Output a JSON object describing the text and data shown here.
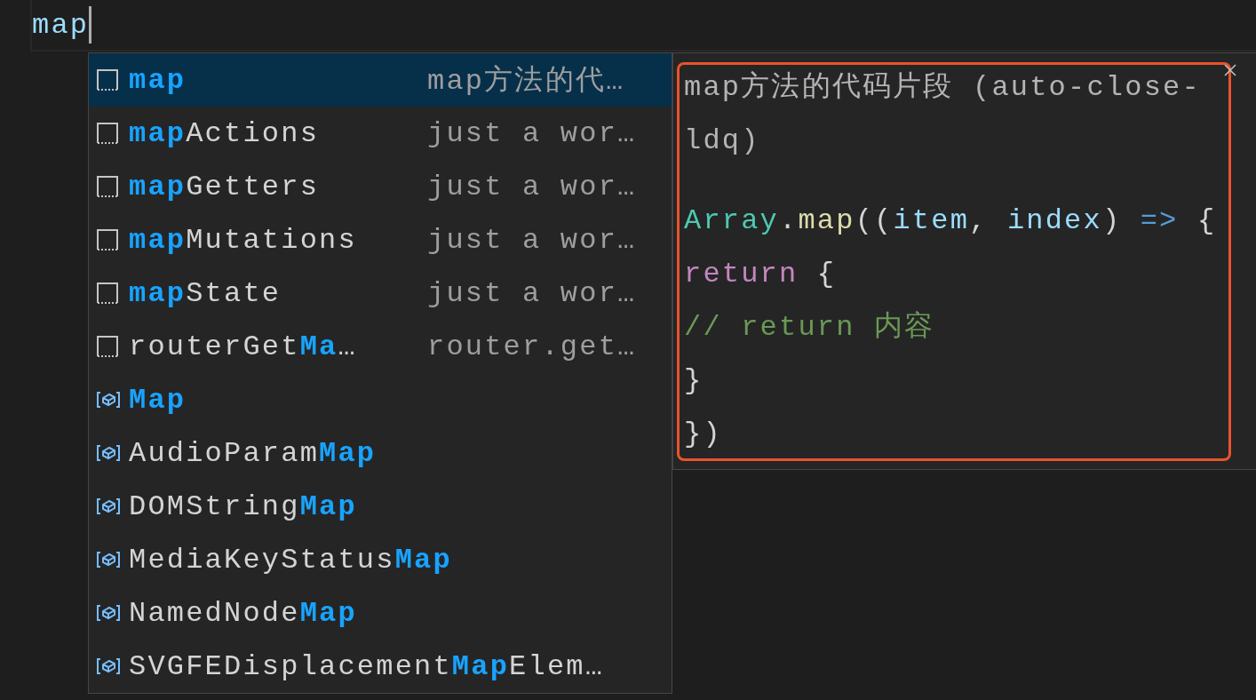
{
  "editor": {
    "text": "map"
  },
  "suggestions": [
    {
      "kind": "snippet",
      "label": "**map**",
      "detail": "map方法的代…",
      "selected": true
    },
    {
      "kind": "snippet",
      "label": "**map**Actions",
      "detail": "just a wor…",
      "selected": false
    },
    {
      "kind": "snippet",
      "label": "**map**Getters",
      "detail": "just a wor…",
      "selected": false
    },
    {
      "kind": "snippet",
      "label": "**map**Mutations",
      "detail": "just a wor…",
      "selected": false
    },
    {
      "kind": "snippet",
      "label": "**map**State",
      "detail": "just a wor…",
      "selected": false
    },
    {
      "kind": "snippet",
      "label": "routerGet**Ma**…",
      "detail": "router.get…",
      "selected": false
    },
    {
      "kind": "class",
      "label": "**Map**",
      "selected": false
    },
    {
      "kind": "class",
      "label": "AudioParam**Map**",
      "selected": false
    },
    {
      "kind": "class",
      "label": "DOMString**Map**",
      "selected": false
    },
    {
      "kind": "class",
      "label": "MediaKeyStatus**Map**",
      "selected": false
    },
    {
      "kind": "class",
      "label": "NamedNode**Map**",
      "selected": false
    },
    {
      "kind": "class",
      "label": "SVGFEDisplacement**Map**Elem…",
      "selected": false
    }
  ],
  "details": {
    "title": "map方法的代码片段 (auto-close-ldq)",
    "code": [
      [
        {
          "kind": "type",
          "text": "Array"
        },
        {
          "kind": "plain",
          "text": "."
        },
        {
          "kind": "function",
          "text": "map"
        },
        {
          "kind": "plain",
          "text": "(("
        },
        {
          "kind": "param",
          "text": "item"
        },
        {
          "kind": "plain",
          "text": ", "
        },
        {
          "kind": "param",
          "text": "index"
        },
        {
          "kind": "plain",
          "text": ") "
        },
        {
          "kind": "operator",
          "text": "=>"
        },
        {
          "kind": "plain",
          "text": " {"
        }
      ],
      [
        {
          "kind": "keyword",
          "text": "return"
        },
        {
          "kind": "plain",
          "text": " {"
        }
      ],
      [
        {
          "kind": "comment",
          "text": "// return 内容"
        }
      ],
      [
        {
          "kind": "plain",
          "text": "}"
        }
      ],
      [
        {
          "kind": "plain",
          "text": "})"
        }
      ]
    ]
  }
}
